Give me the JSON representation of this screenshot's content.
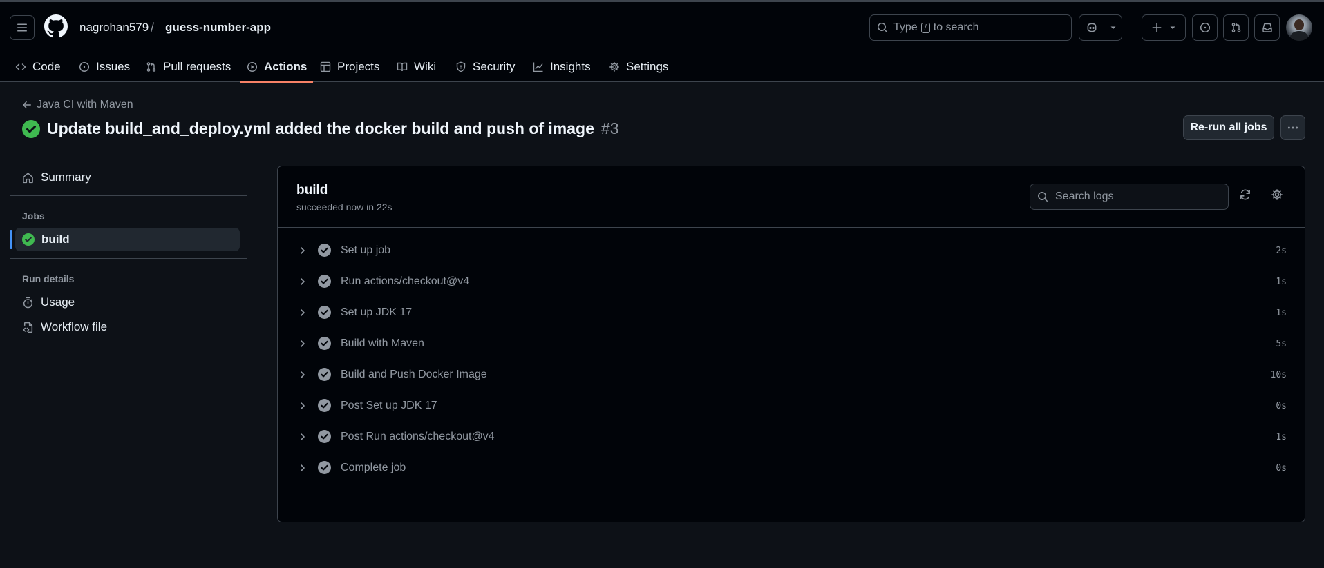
{
  "header": {
    "owner": "nagrohan579",
    "separator": "/",
    "repo": "guess-number-app",
    "search": {
      "prefix": "Type",
      "key": "/",
      "suffix": "to search"
    }
  },
  "nav": {
    "tabs": [
      {
        "label": "Code",
        "icon": "code-icon"
      },
      {
        "label": "Issues",
        "icon": "issue-opened-icon"
      },
      {
        "label": "Pull requests",
        "icon": "git-pull-request-icon"
      },
      {
        "label": "Actions",
        "icon": "play-icon",
        "active": true
      },
      {
        "label": "Projects",
        "icon": "table-icon"
      },
      {
        "label": "Wiki",
        "icon": "book-icon"
      },
      {
        "label": "Security",
        "icon": "shield-icon"
      },
      {
        "label": "Insights",
        "icon": "graph-icon"
      },
      {
        "label": "Settings",
        "icon": "gear-icon"
      }
    ]
  },
  "run": {
    "workflow_name": "Java CI with Maven",
    "title": "Update build_and_deploy.yml added the docker build and push of image",
    "run_number": "#3",
    "rerun_label": "Re-run all jobs",
    "status": "success"
  },
  "sidebar": {
    "summary_label": "Summary",
    "jobs_heading": "Jobs",
    "job_label": "build",
    "run_details_heading": "Run details",
    "usage_label": "Usage",
    "workflow_file_label": "Workflow file"
  },
  "job": {
    "name": "build",
    "subtitle": "succeeded now in 22s",
    "search_placeholder": "Search logs",
    "steps": [
      {
        "name": "Set up job",
        "duration": "2s"
      },
      {
        "name": "Run actions/checkout@v4",
        "duration": "1s"
      },
      {
        "name": "Set up JDK 17",
        "duration": "1s"
      },
      {
        "name": "Build with Maven",
        "duration": "5s"
      },
      {
        "name": "Build and Push Docker Image",
        "duration": "10s"
      },
      {
        "name": "Post Set up JDK 17",
        "duration": "0s"
      },
      {
        "name": "Post Run actions/checkout@v4",
        "duration": "1s"
      },
      {
        "name": "Complete job",
        "duration": "0s"
      }
    ]
  },
  "colors": {
    "success": "#3fb950",
    "accent_tab": "#f78166",
    "active_indicator": "#4493f8",
    "background": "#0d1117",
    "header_bg": "#010409"
  }
}
